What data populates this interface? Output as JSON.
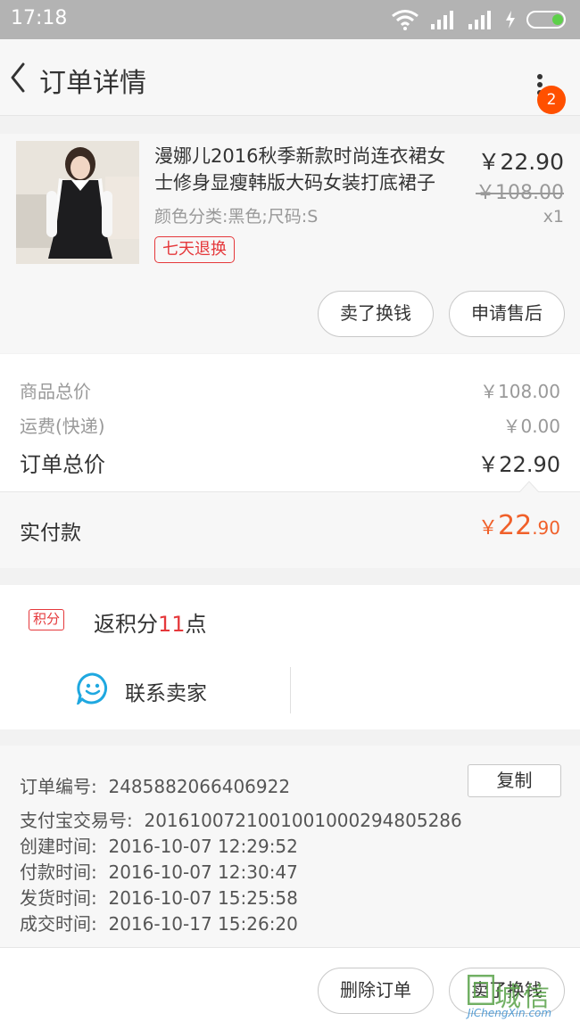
{
  "status_bar": {
    "time": "17:18"
  },
  "nav": {
    "title": "订单详情",
    "badge_count": "2"
  },
  "item": {
    "title": "漫娜儿2016秋季新款时尚连衣裙女士修身显瘦韩版大码女装打底裙子",
    "sku": "颜色分类:黑色;尺码:S",
    "tag": "七天退换",
    "price_now": "￥22.90",
    "price_old": "￥108.00",
    "quantity": "x1",
    "buttons": {
      "sell": "卖了换钱",
      "after_sale": "申请售后"
    }
  },
  "summary": {
    "goods_total_label": "商品总价",
    "goods_total_value": "￥108.00",
    "shipping_label": "运费(快递)",
    "shipping_value": "￥0.00",
    "order_total_label": "订单总价",
    "order_total_value": "￥22.90"
  },
  "paid": {
    "label": "实付款",
    "currency": "￥",
    "integer": "22",
    "decimal": ".90"
  },
  "points": {
    "tag": "积分",
    "prefix": "返积分",
    "amount": "11",
    "suffix": "点"
  },
  "contact": {
    "label": "联系卖家"
  },
  "order_info": {
    "copy_button": "复制",
    "lines": [
      {
        "label": "订单编号:",
        "value": "2485882066406922"
      },
      {
        "label": "支付宝交易号:",
        "value": "2016100721001001000294805286"
      },
      {
        "label": "创建时间:",
        "value": "2016-10-07 12:29:52"
      },
      {
        "label": "付款时间:",
        "value": "2016-10-07 12:30:47"
      },
      {
        "label": "发货时间:",
        "value": "2016-10-07 15:25:58"
      },
      {
        "label": "成交时间:",
        "value": "2016-10-17 15:26:20"
      }
    ]
  },
  "bottom": {
    "delete": "删除订单",
    "sell": "卖了换钱"
  },
  "watermark": {
    "logo": "城信",
    "url": "JiChengXin.com"
  },
  "colors": {
    "accent": "#f0602a",
    "badge": "#ff5000",
    "tag_red": "#e5383b",
    "contact_blue": "#1fa8e0"
  }
}
